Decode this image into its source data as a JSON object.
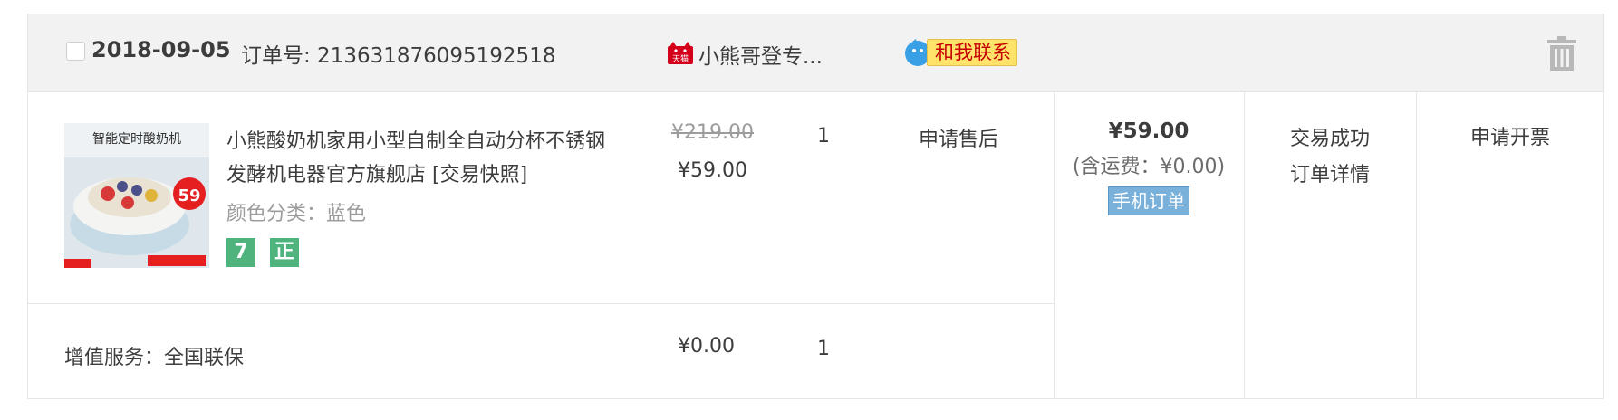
{
  "header": {
    "date": "2018-09-05",
    "order_no_label": "订单号: 213631876095192518",
    "shop_badge": "天猫",
    "shop_name": "小熊哥登专...",
    "contact_label": "和我联系"
  },
  "item": {
    "thumbnail_banner": "智能定时酸奶机",
    "thumbnail_price_tag": "59",
    "title": "小熊酸奶机家用小型自制全自动分杯不锈钢发酵机电器官方旗舰店 [交易快照]",
    "sku": "颜色分类：蓝色",
    "badges": [
      "7",
      "正"
    ],
    "original_price": "¥219.00",
    "price": "¥59.00",
    "quantity": "1",
    "after_sale": "申请售后"
  },
  "summary": {
    "total": "¥59.00",
    "shipping": "(含运费：¥0.00)",
    "mobile_order": "手机订单",
    "status": "交易成功",
    "detail_link": "订单详情",
    "invoice": "申请开票"
  },
  "service": {
    "label": "增值服务：全国联保",
    "price": "¥0.00",
    "quantity": "1"
  },
  "colors": {
    "header_bg": "#f2f2f2",
    "border": "#e6e6e6",
    "badge_green": "#4eb37d",
    "mobile_badge": "#7ab1da",
    "contact_bg": "#ffe26a",
    "contact_text": "#c40000",
    "tmall_red": "#d4001a"
  },
  "icons": {
    "trash": "trash-icon",
    "contact": "chat-bubble-icon",
    "shop": "tmall-icon"
  }
}
